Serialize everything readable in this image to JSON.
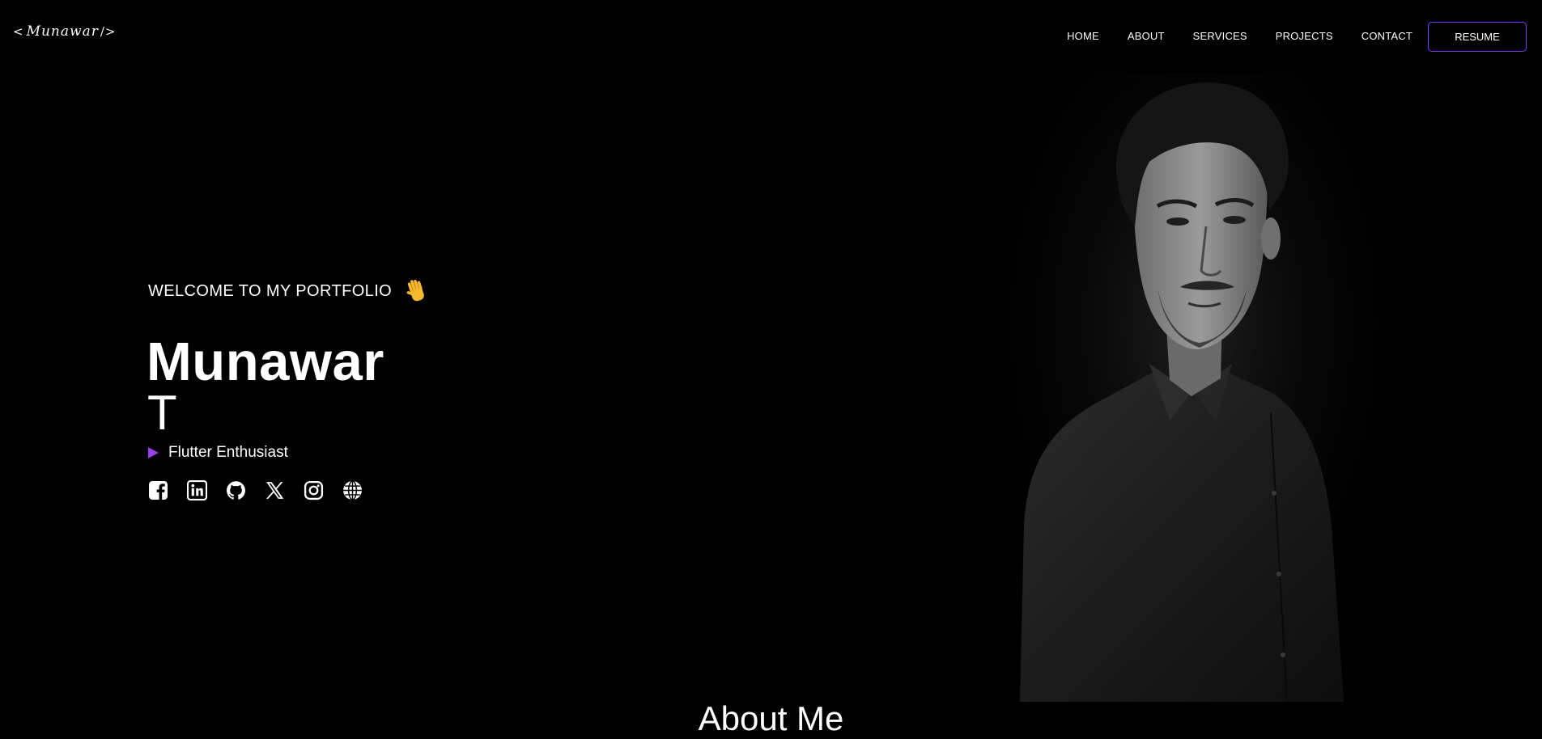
{
  "header": {
    "logo_open": "<",
    "logo_signature": "Munawar",
    "logo_close": "/>",
    "nav": [
      {
        "label": "HOME"
      },
      {
        "label": "ABOUT"
      },
      {
        "label": "SERVICES"
      },
      {
        "label": "PROJECTS"
      },
      {
        "label": "CONTACT"
      }
    ],
    "resume_label": "RESUME"
  },
  "hero": {
    "welcome": "WELCOME TO MY PORTFOLIO",
    "welcome_icon": "waving-hand-icon",
    "first_name": "Munawar",
    "last_name": "T",
    "role": "Flutter Enthusiast",
    "role_icon": "play-icon",
    "socials": [
      {
        "icon": "facebook-icon"
      },
      {
        "icon": "linkedin-icon"
      },
      {
        "icon": "github-icon"
      },
      {
        "icon": "x-twitter-icon"
      },
      {
        "icon": "instagram-icon"
      },
      {
        "icon": "globe-icon"
      }
    ]
  },
  "about": {
    "title": "About Me"
  },
  "colors": {
    "background": "#000000",
    "text": "#ffffff",
    "accent": "#7b3ff2"
  }
}
